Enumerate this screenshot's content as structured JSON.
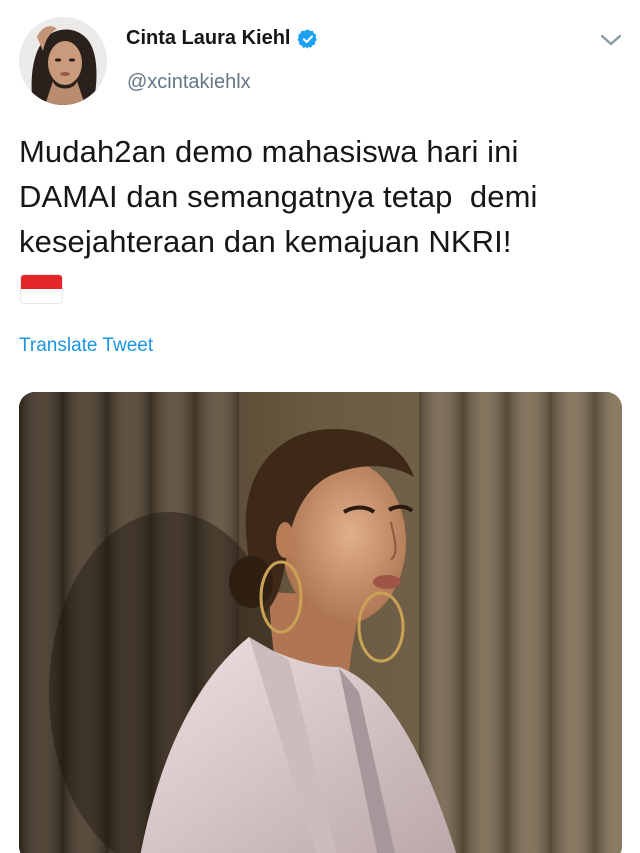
{
  "user": {
    "display_name": "Cinta Laura Kiehl",
    "handle": "@xcintakiehlx",
    "verified": true,
    "avatar_icon": "profile-avatar"
  },
  "menu": {
    "icon": "chevron-down-icon"
  },
  "tweet": {
    "text": "Mudah2an demo mahasiswa hari ini\nDAMAI dan semangatnya tetap  demi\nkesejahteraan dan kemajuan NKRI!",
    "flag_emoji": "indonesia-flag",
    "translate_label": "Translate Tweet"
  },
  "colors": {
    "link": "#1b95e0",
    "verified_badge": "#1da1f2",
    "secondary_text": "#657786",
    "flag_red": "#e5252a"
  }
}
